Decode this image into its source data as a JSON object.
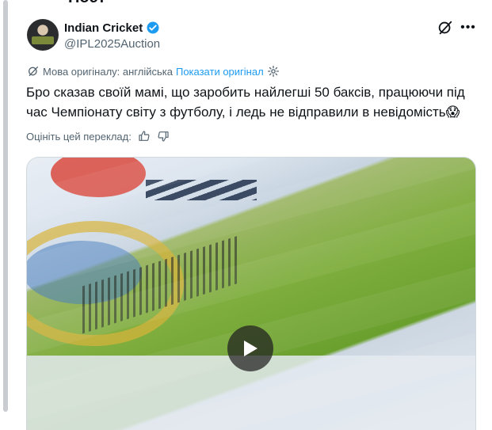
{
  "header": {
    "title": "Пост"
  },
  "tweet": {
    "display_name": "Indian Cricket",
    "handle": "@IPL2025Auction",
    "original_language_label": "Мова оригіналу: англійська",
    "show_original_label": "Показати оригінал",
    "text": "Бро сказав своїй мамі, що заробить найлегші 50 баксів, працюючи під час Чемпіонату світу з футболу, і ледь не відправили в невідомість😱",
    "rate_translation_label": "Оцініть цей переклад:"
  },
  "icons": {
    "verified": "verified-badge-icon",
    "grok": "grok-icon",
    "more": "more-icon",
    "translate": "translate-icon",
    "settings": "gear-icon",
    "thumbs_up": "thumbs-up-icon",
    "thumbs_down": "thumbs-down-icon",
    "play": "play-icon"
  },
  "colors": {
    "accent": "#1d9bf0",
    "secondary_text": "#536471",
    "text": "#0f1419"
  }
}
